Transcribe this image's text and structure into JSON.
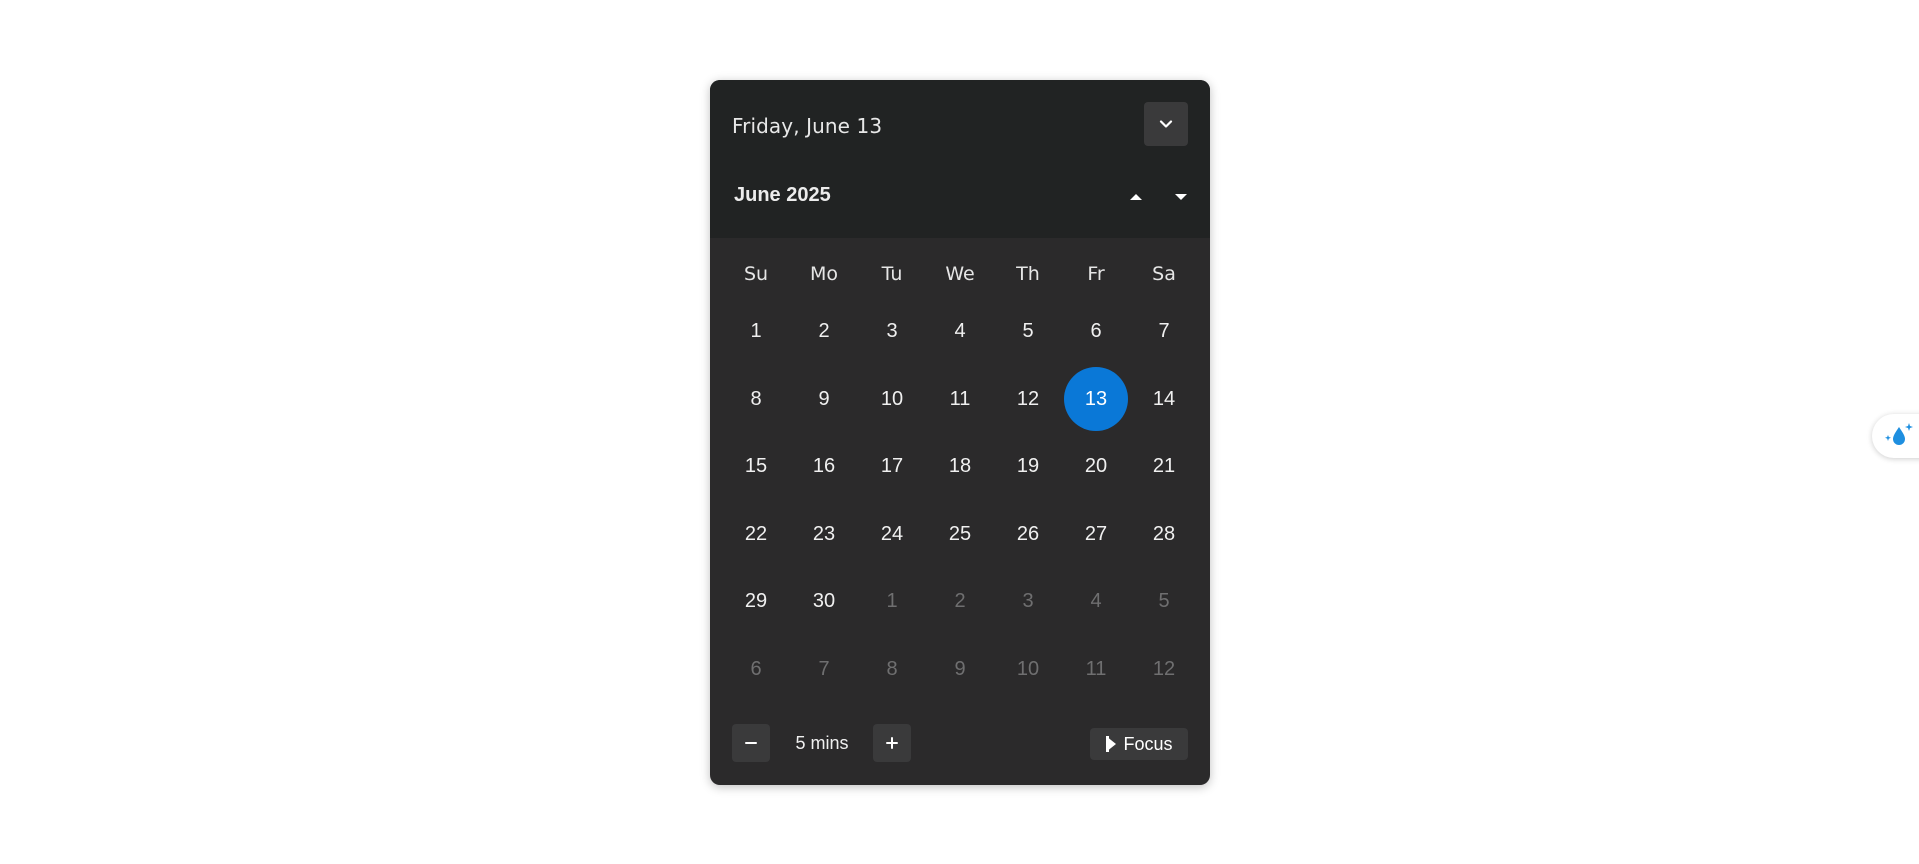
{
  "header": {
    "date_line": "Friday, June 13",
    "collapse_icon": "chevron-down-icon"
  },
  "calendar": {
    "month_title": "June 2025",
    "nav_up_icon": "triangle-up-icon",
    "nav_down_icon": "triangle-down-icon",
    "weekdays": [
      "Su",
      "Mo",
      "Tu",
      "We",
      "Th",
      "Fr",
      "Sa"
    ],
    "days": [
      {
        "label": "1",
        "state": "current"
      },
      {
        "label": "2",
        "state": "current"
      },
      {
        "label": "3",
        "state": "current"
      },
      {
        "label": "4",
        "state": "current"
      },
      {
        "label": "5",
        "state": "current"
      },
      {
        "label": "6",
        "state": "current"
      },
      {
        "label": "7",
        "state": "current"
      },
      {
        "label": "8",
        "state": "current"
      },
      {
        "label": "9",
        "state": "current"
      },
      {
        "label": "10",
        "state": "current"
      },
      {
        "label": "11",
        "state": "current"
      },
      {
        "label": "12",
        "state": "current"
      },
      {
        "label": "13",
        "state": "selected"
      },
      {
        "label": "14",
        "state": "current"
      },
      {
        "label": "15",
        "state": "current"
      },
      {
        "label": "16",
        "state": "current"
      },
      {
        "label": "17",
        "state": "current"
      },
      {
        "label": "18",
        "state": "current"
      },
      {
        "label": "19",
        "state": "current"
      },
      {
        "label": "20",
        "state": "current"
      },
      {
        "label": "21",
        "state": "current"
      },
      {
        "label": "22",
        "state": "current"
      },
      {
        "label": "23",
        "state": "current"
      },
      {
        "label": "24",
        "state": "current"
      },
      {
        "label": "25",
        "state": "current"
      },
      {
        "label": "26",
        "state": "current"
      },
      {
        "label": "27",
        "state": "current"
      },
      {
        "label": "28",
        "state": "current"
      },
      {
        "label": "29",
        "state": "current"
      },
      {
        "label": "30",
        "state": "current"
      },
      {
        "label": "1",
        "state": "other"
      },
      {
        "label": "2",
        "state": "other"
      },
      {
        "label": "3",
        "state": "other"
      },
      {
        "label": "4",
        "state": "other"
      },
      {
        "label": "5",
        "state": "other"
      },
      {
        "label": "6",
        "state": "other"
      },
      {
        "label": "7",
        "state": "other"
      },
      {
        "label": "8",
        "state": "other"
      },
      {
        "label": "9",
        "state": "other"
      },
      {
        "label": "10",
        "state": "other"
      },
      {
        "label": "11",
        "state": "other"
      },
      {
        "label": "12",
        "state": "other"
      }
    ]
  },
  "focus": {
    "minus_label": "−",
    "plus_label": "+",
    "duration_label": "5 mins",
    "focus_label": "Focus",
    "focus_icon": "play-half-icon"
  },
  "side_widget": {
    "icon": "droplet-sparkle-icon"
  },
  "colors": {
    "accent": "#0a78d7",
    "panel": "#2b2a2b",
    "header": "#212323"
  }
}
